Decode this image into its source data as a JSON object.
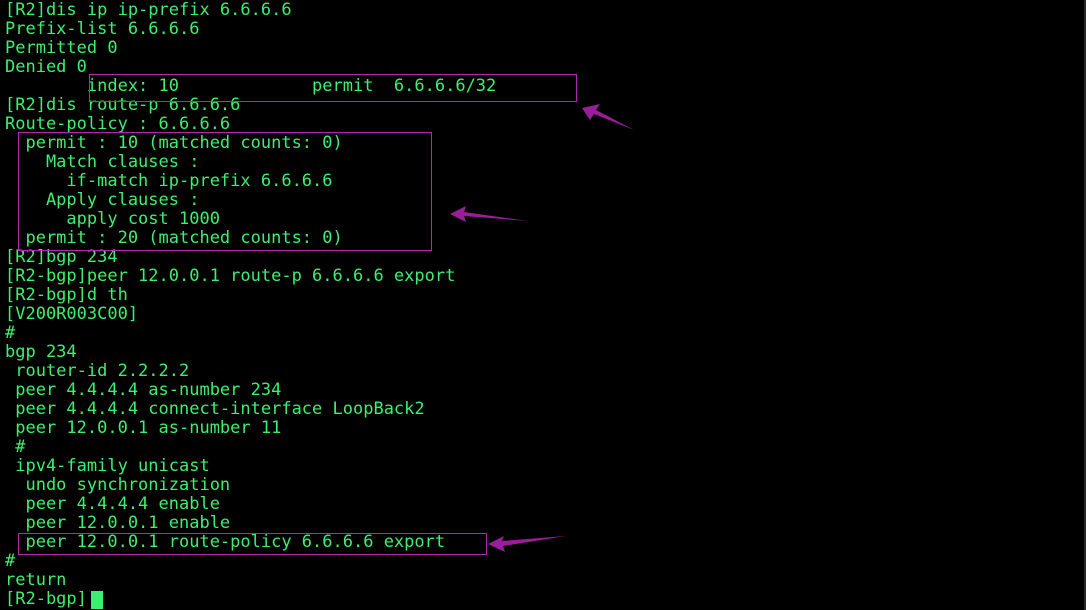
{
  "terminal": {
    "lines": [
      "[R2]dis ip ip-prefix 6.6.6.6",
      "Prefix-list 6.6.6.6",
      "Permitted 0",
      "Denied 0",
      "        index: 10             permit  6.6.6.6/32",
      "[R2]dis route-p 6.6.6.6",
      "Route-policy : 6.6.6.6",
      "  permit : 10 (matched counts: 0)",
      "    Match clauses :",
      "      if-match ip-prefix 6.6.6.6",
      "    Apply clauses :",
      "      apply cost 1000",
      "  permit : 20 (matched counts: 0)",
      "[R2]bgp 234",
      "[R2-bgp]peer 12.0.0.1 route-p 6.6.6.6 export",
      "[R2-bgp]d th",
      "[V200R003C00]",
      "#",
      "bgp 234",
      " router-id 2.2.2.2",
      " peer 4.4.4.4 as-number 234",
      " peer 4.4.4.4 connect-interface LoopBack2",
      " peer 12.0.0.1 as-number 11",
      " #",
      " ipv4-family unicast",
      "  undo synchronization",
      "  peer 4.4.4.4 enable",
      "  peer 12.0.0.1 enable",
      "  peer 12.0.0.1 route-policy 6.6.6.6 export",
      "#",
      "return",
      "[R2-bgp]"
    ]
  },
  "colors": {
    "text": "#3CF06E",
    "background": "#000000",
    "annotation": "#B02AB0",
    "arrow": "#9A1E9A"
  },
  "icons": {
    "cursor": "block-cursor",
    "annotation_arrow": "arrow-pointer-icon"
  }
}
